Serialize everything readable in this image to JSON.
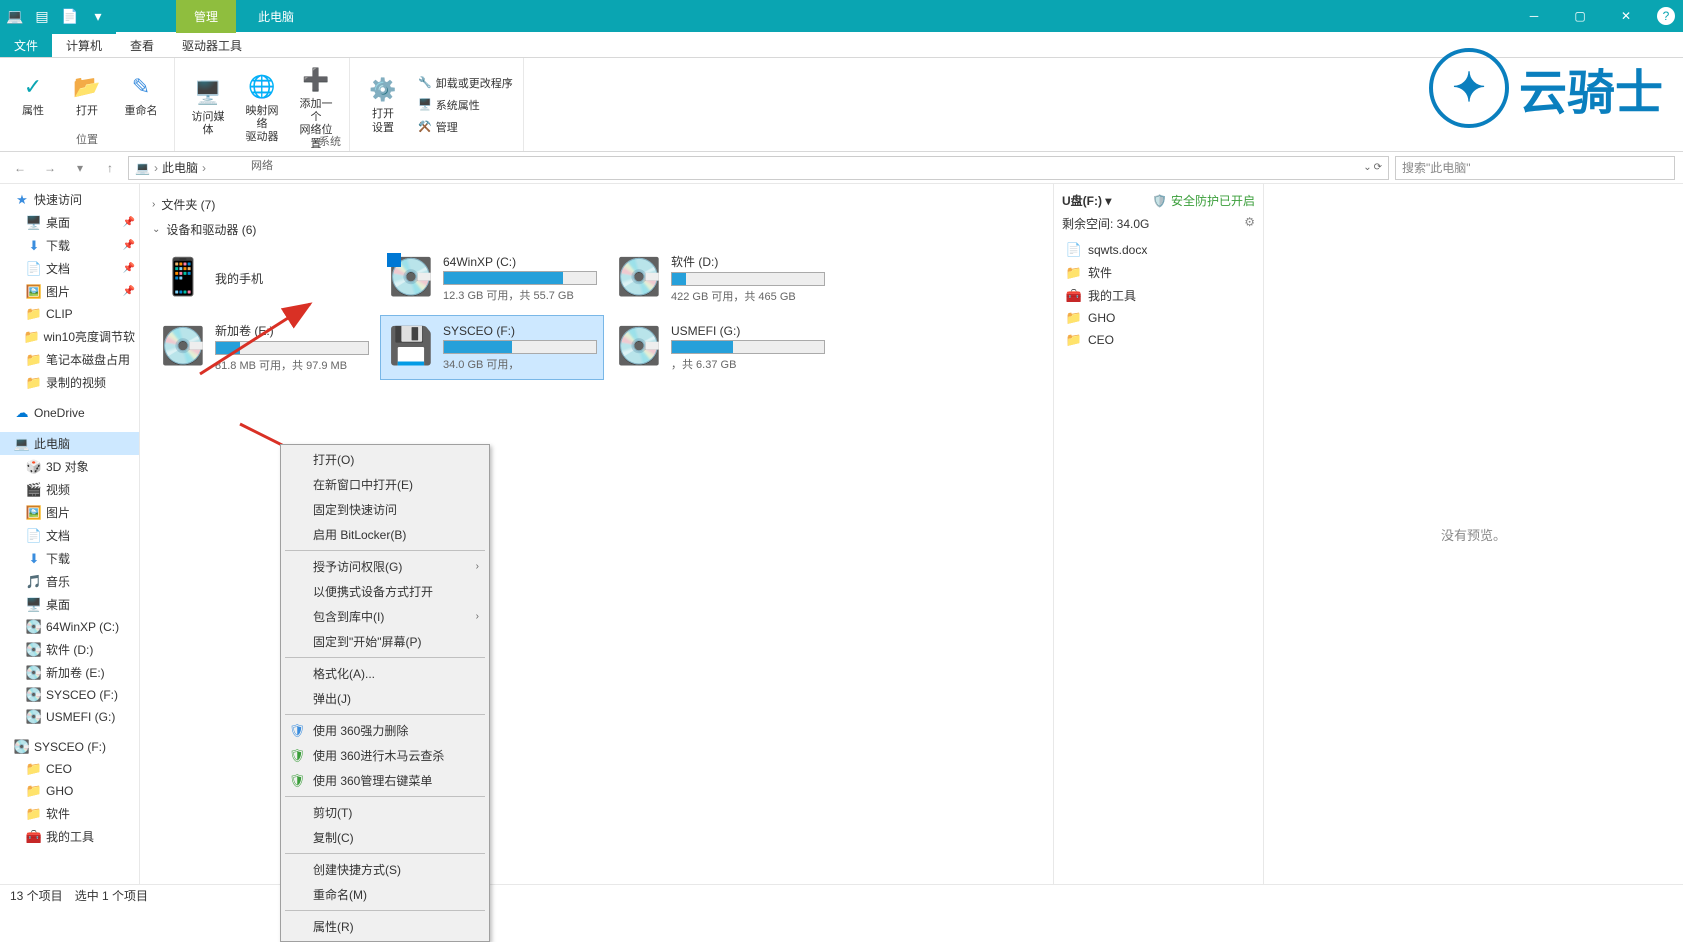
{
  "titlebar": {
    "manage_tab": "管理",
    "title": "此电脑"
  },
  "ribbon_tabs": {
    "file": "文件",
    "computer": "计算机",
    "view": "查看",
    "drive_tools": "驱动器工具"
  },
  "ribbon": {
    "group_location": "位置",
    "group_network": "网络",
    "group_system": "系统",
    "btn_properties": "属性",
    "btn_open": "打开",
    "btn_rename": "重命名",
    "btn_media": "访问媒体",
    "btn_map": "映射网络\n驱动器",
    "btn_add": "添加一个\n网络位置",
    "btn_settings": "打开\n设置",
    "sys_uninstall": "卸载或更改程序",
    "sys_properties": "系统属性",
    "sys_manage": "管理"
  },
  "watermark": "云骑士",
  "address": {
    "crumb": "此电脑",
    "search_placeholder": "搜索\"此电脑\""
  },
  "sidebar": {
    "quick_access": "快速访问",
    "desktop": "桌面",
    "downloads": "下载",
    "documents": "文档",
    "pictures": "图片",
    "clip": "CLIP",
    "win10": "win10亮度调节软",
    "notebook": "笔记本磁盘占用",
    "recorded": "录制的视频",
    "onedrive": "OneDrive",
    "this_pc": "此电脑",
    "o3d": "3D 对象",
    "videos": "视频",
    "pictures2": "图片",
    "documents2": "文档",
    "downloads2": "下载",
    "music": "音乐",
    "desktop2": "桌面",
    "drive_c": "64WinXP (C:)",
    "drive_d": "软件 (D:)",
    "drive_e": "新加卷 (E:)",
    "drive_f": "SYSCEO (F:)",
    "drive_g": "USMEFI (G:)",
    "sysceo_f": "SYSCEO (F:)",
    "ceo": "CEO",
    "gho": "GHO",
    "software": "软件",
    "mytools": "我的工具"
  },
  "main": {
    "group_folders": "文件夹 (7)",
    "group_devices": "设备和驱动器 (6)",
    "phone": "我的手机",
    "drive_c": {
      "name": "64WinXP (C:)",
      "detail": "12.3 GB 可用，共 55.7 GB",
      "fill": 78
    },
    "drive_d": {
      "name": "软件 (D:)",
      "detail": "422 GB 可用，共 465 GB",
      "fill": 9
    },
    "drive_e": {
      "name": "新加卷 (E:)",
      "detail": "81.8 MB 可用，共 97.9 MB",
      "fill": 16
    },
    "drive_f": {
      "name": "SYSCEO (F:)",
      "detail": "34.0 GB 可用，",
      "fill": 45
    },
    "drive_g": {
      "name": "USMEFI (G:)",
      "detail": "，共 6.37 GB",
      "fill": 40
    }
  },
  "right_panel": {
    "title": "U盘(F:)",
    "security": "安全防护已开启",
    "free_space": "剩余空间: 34.0G",
    "items": [
      {
        "icon": "📄",
        "label": "sqwts.docx"
      },
      {
        "icon": "📁",
        "label": "软件"
      },
      {
        "icon": "🧰",
        "label": "我的工具"
      },
      {
        "icon": "📁",
        "label": "GHO"
      },
      {
        "icon": "📁",
        "label": "CEO"
      }
    ]
  },
  "preview": "没有预览。",
  "context_menu": {
    "open": "打开(O)",
    "open_new": "在新窗口中打开(E)",
    "pin_quick": "固定到快速访问",
    "bitlocker": "启用 BitLocker(B)",
    "grant_access": "授予访问权限(G)",
    "portable": "以便携式设备方式打开",
    "include": "包含到库中(I)",
    "pin_start": "固定到\"开始\"屏幕(P)",
    "format": "格式化(A)...",
    "eject": "弹出(J)",
    "del360": "使用 360强力删除",
    "scan360": "使用 360进行木马云查杀",
    "mgr360": "使用 360管理右键菜单",
    "cut": "剪切(T)",
    "copy": "复制(C)",
    "shortcut": "创建快捷方式(S)",
    "rename": "重命名(M)",
    "properties": "属性(R)"
  },
  "statusbar": {
    "items": "13 个项目",
    "selected": "选中 1 个项目"
  }
}
